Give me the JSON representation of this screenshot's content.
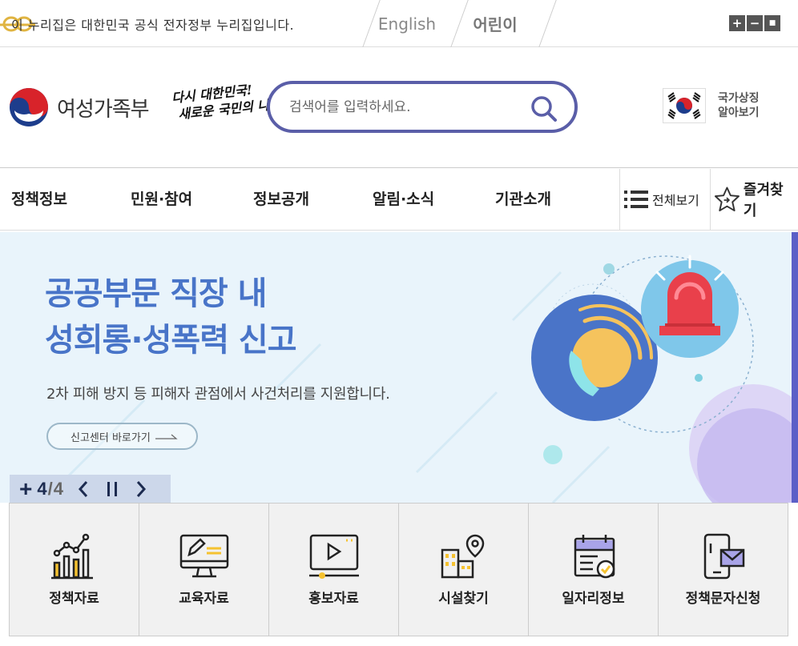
{
  "topbar": {
    "gov_notice": "이 누리집은 대한민국 공식 전자정부 누리집입니다.",
    "lang_english": "English",
    "lang_kids": "어린이",
    "zoom_in": "+",
    "zoom_out": "−",
    "zoom_reset": "■"
  },
  "header": {
    "logo_text": "여성가족부",
    "slogan_line1": "다시 대한민국!",
    "slogan_line2": "새로운 국민의 나라",
    "search_placeholder": "검색어를 입력하세요.",
    "national_symbol_line1": "국가상징",
    "national_symbol_line2": "알아보기"
  },
  "nav": {
    "items": [
      {
        "label": "정책정보"
      },
      {
        "label": "민원·참여"
      },
      {
        "label": "정보공개"
      },
      {
        "label": "알림·소식"
      },
      {
        "label": "기관소개"
      }
    ],
    "all_view": "전체보기",
    "favorites": "즐겨찾기"
  },
  "banner": {
    "title_line1": "공공부문 직장 내",
    "title_line2": "성희롱·성폭력 신고",
    "description": "2차 피해 방지 등 피해자 관점에서 사건처리를 지원합니다.",
    "link_label": "신고센터 바로가기",
    "current": "4",
    "total": "4",
    "separator": "/"
  },
  "quick_menu": {
    "items": [
      {
        "label": "정책자료",
        "icon": "chart-icon"
      },
      {
        "label": "교육자료",
        "icon": "monitor-edit-icon"
      },
      {
        "label": "홍보자료",
        "icon": "video-play-icon"
      },
      {
        "label": "시설찾기",
        "icon": "building-location-icon"
      },
      {
        "label": "일자리정보",
        "icon": "calendar-check-icon"
      },
      {
        "label": "정책문자신청",
        "icon": "phone-message-icon"
      }
    ]
  },
  "colors": {
    "accent": "#5a5ea8",
    "banner_bg": "#e9f4fb",
    "banner_title": "#4874c8",
    "icon_yellow": "#f5c230"
  }
}
